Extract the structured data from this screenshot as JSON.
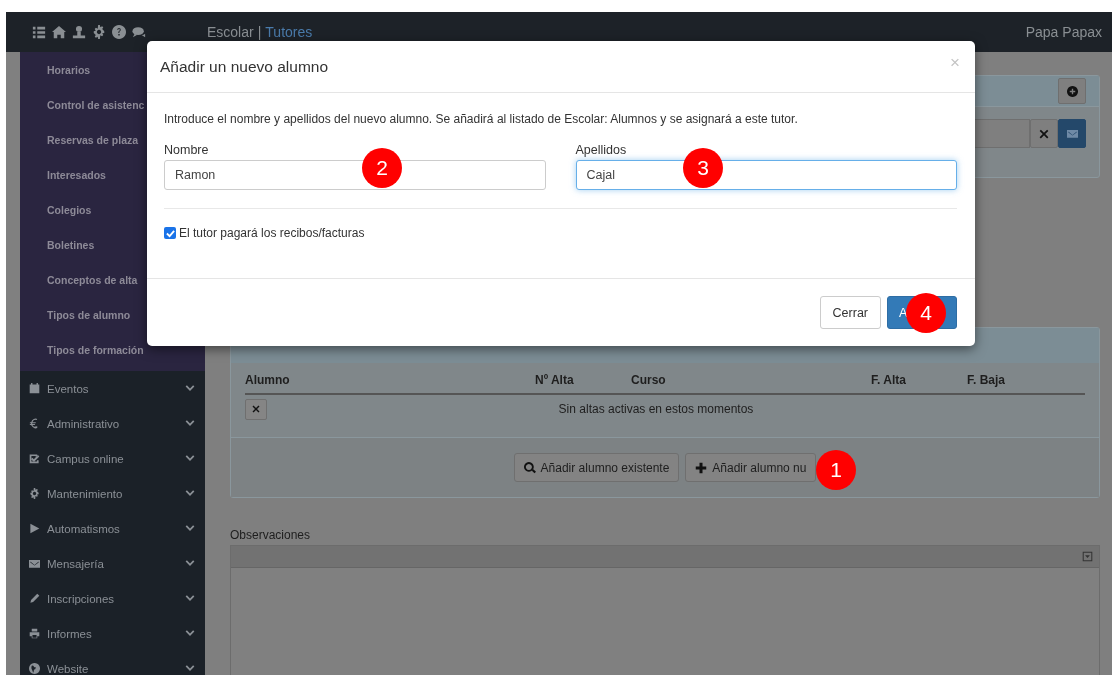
{
  "topbar": {
    "brand": "Escolar",
    "separator": "|",
    "section": "Tutores",
    "user": "Papa Papax"
  },
  "sidebar": {
    "subitems": [
      "Horarios",
      "Control de asistenc",
      "Reservas de plaza",
      "Interesados",
      "Colegios",
      "Boletines",
      "Conceptos de alta",
      "Tipos de alumno",
      "Tipos de formación"
    ],
    "sections": [
      {
        "label": "Eventos"
      },
      {
        "label": "Administrativo"
      },
      {
        "label": "Campus online"
      },
      {
        "label": "Mantenimiento"
      },
      {
        "label": "Automatismos"
      },
      {
        "label": "Mensajería"
      },
      {
        "label": "Inscripciones"
      },
      {
        "label": "Informes"
      },
      {
        "label": "Website"
      }
    ]
  },
  "main": {
    "table": {
      "columns": [
        "Alumno",
        "Nº Alta",
        "Curso",
        "F. Alta",
        "F. Baja"
      ],
      "empty_message": "Sin altas activas en estos momentos"
    },
    "buttons": [
      {
        "label": "Añadir alumno existente"
      },
      {
        "label": "Añadir alumno nu"
      }
    ],
    "observaciones_label": "Observaciones"
  },
  "modal": {
    "title": "Añadir un nuevo alumno",
    "close": "×",
    "intro": "Introduce el nombre y apellidos del nuevo alumno. Se añadirá al listado de Escolar: Alumnos y se asignará a este tutor.",
    "fields": [
      {
        "label": "Nombre",
        "value": "Ramon",
        "focused": false
      },
      {
        "label": "Apellidos",
        "value": "Cajal",
        "focused": true
      }
    ],
    "checkbox": {
      "label": "El tutor pagará los recibos/facturas",
      "checked": true
    },
    "buttons": [
      {
        "label": "Cerrar",
        "kind": "default"
      },
      {
        "label": "A",
        "kind": "primary"
      }
    ]
  },
  "annotations": [
    {
      "label": "1"
    },
    {
      "label": "2"
    },
    {
      "label": "3"
    },
    {
      "label": "4"
    }
  ]
}
